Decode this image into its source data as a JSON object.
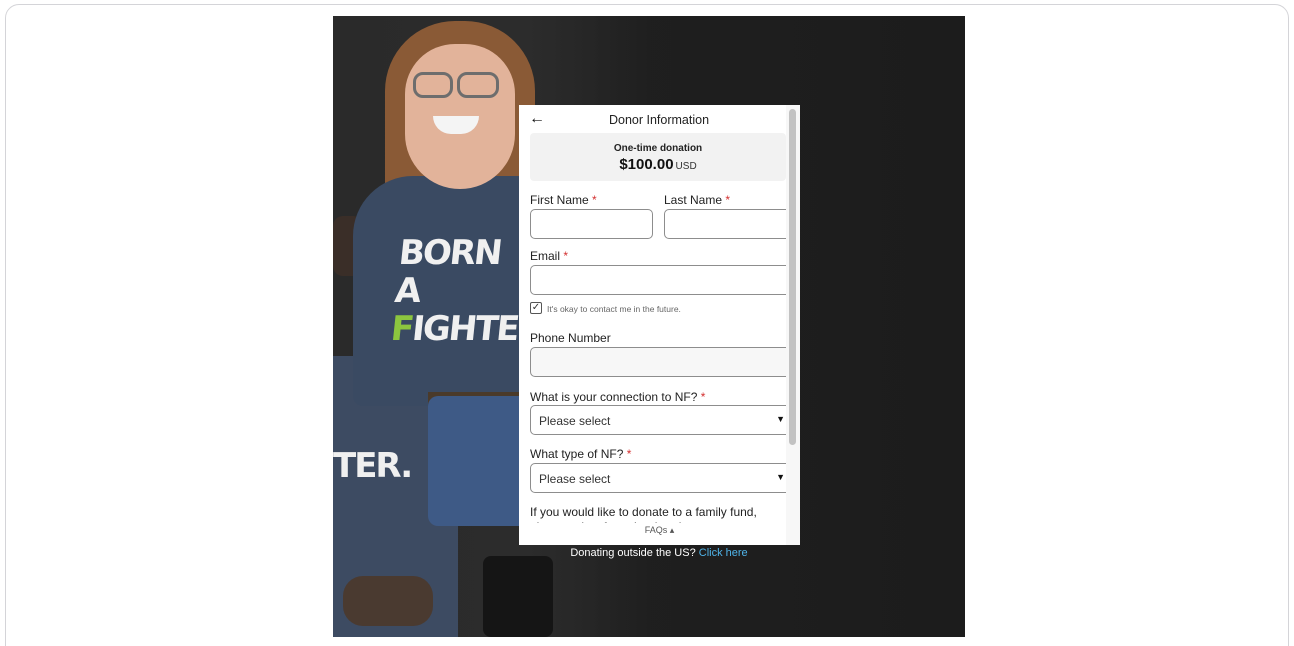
{
  "panel": {
    "title": "Donor Information",
    "back_icon": "back-arrow-icon",
    "summary": {
      "label": "One-time donation",
      "amount": "$100.00",
      "currency": "USD"
    },
    "first_name": {
      "label": "First Name",
      "required": "*",
      "value": ""
    },
    "last_name": {
      "label": "Last Name",
      "required": "*",
      "value": ""
    },
    "email": {
      "label": "Email",
      "required": "*",
      "value": ""
    },
    "contact_optin": {
      "label": "It's okay to contact me in the future.",
      "checked": true,
      "mark": "✓"
    },
    "phone": {
      "label": "Phone Number",
      "value": ""
    },
    "connection": {
      "label": "What is your connection to NF?",
      "required": "*",
      "selected": "Please select"
    },
    "nf_type": {
      "label": "What type of NF?",
      "required": "*",
      "selected": "Please select"
    },
    "family_fund_text": "If you would like to donate to a family fund, please select from the dropdown",
    "faq_label": "FAQs ▴"
  },
  "below": {
    "text": "Donating outside the US?",
    "link": "Click here"
  },
  "hero_shirt": {
    "line1_a": "BORN",
    "line2_a": "A ",
    "line2_g": "F",
    "line2_b": "IGHTER.",
    "person2": "TER."
  },
  "colors": {
    "accent_link": "#4fb3e8",
    "required": "#d32f2f",
    "hero_bg": "#1f1f1f"
  }
}
